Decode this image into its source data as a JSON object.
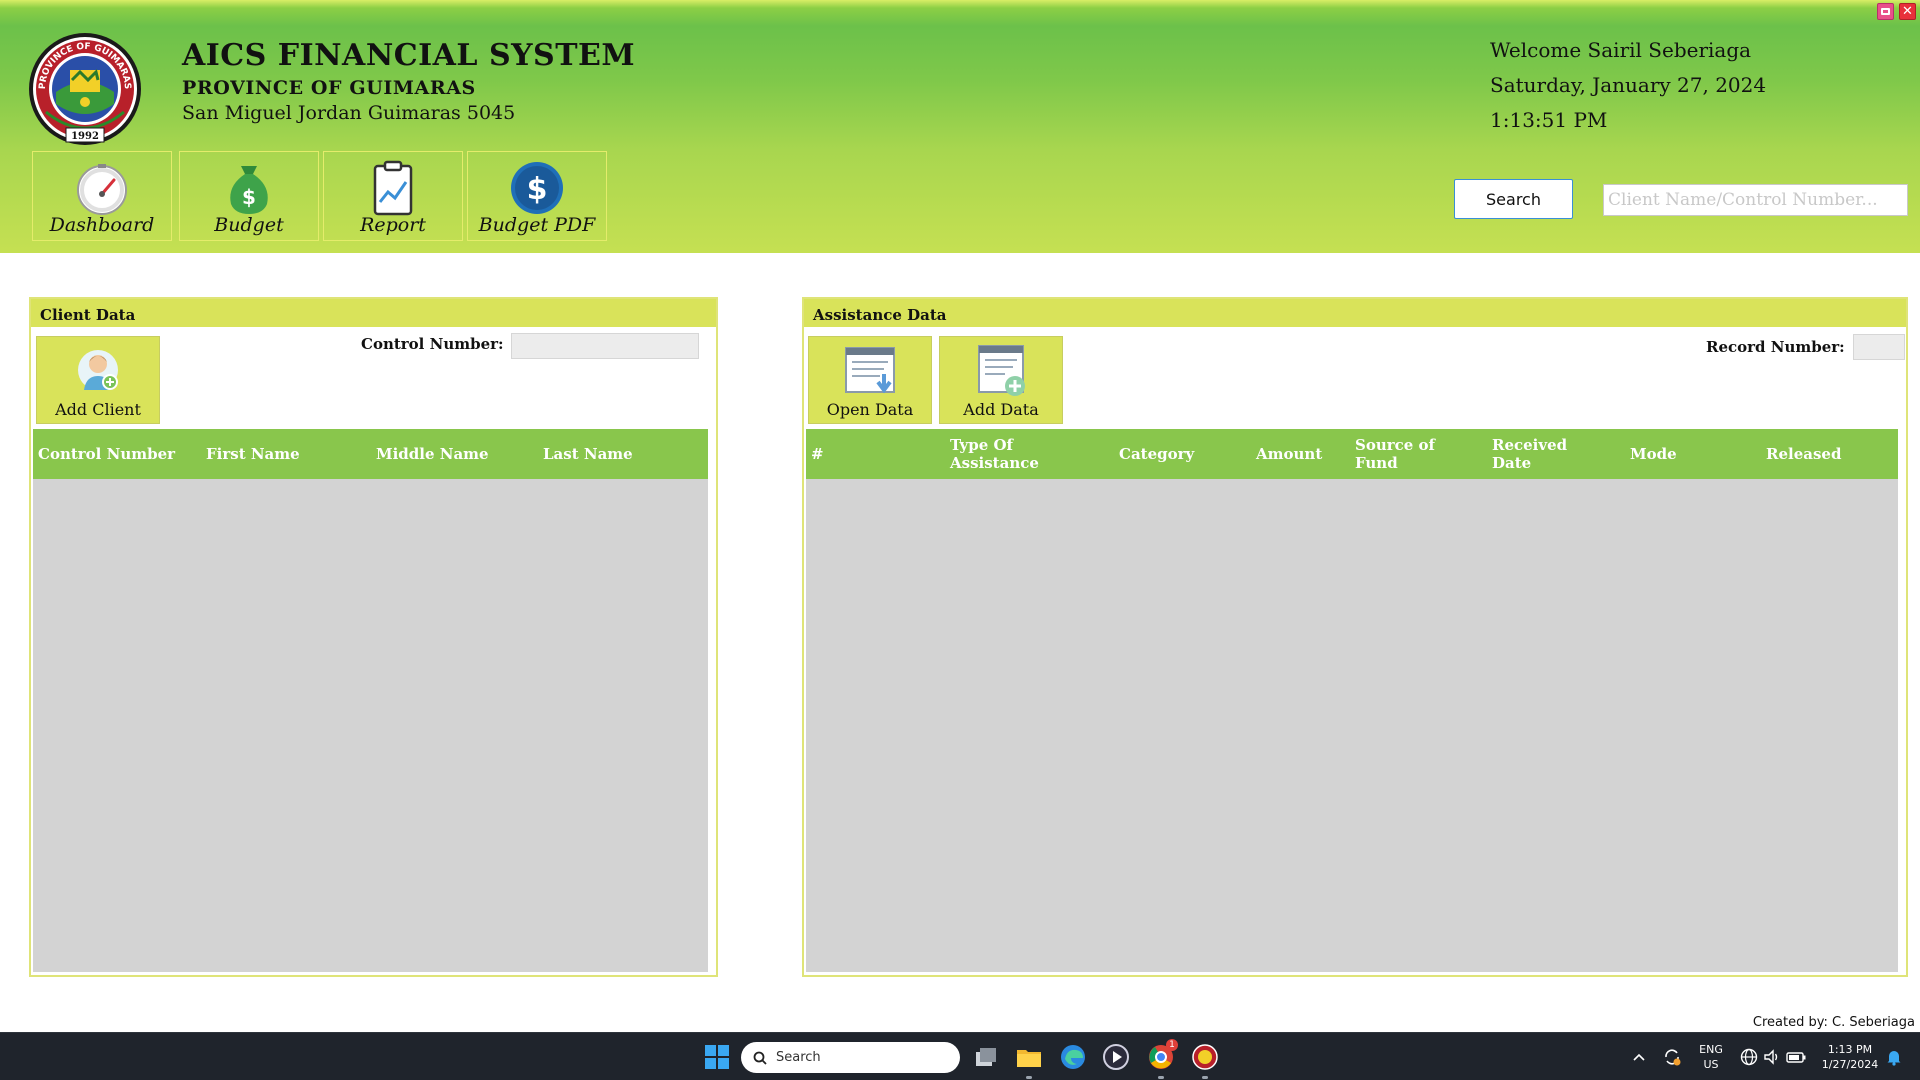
{
  "app": {
    "title": "AICS FINANCIAL SYSTEM",
    "province": "PROVINCE OF GUIMARAS",
    "address": "San Miguel Jordan Guimaras 5045",
    "logo_text": "PROVINCE OF GUIMARAS",
    "logo_year": "1992"
  },
  "session": {
    "welcome": "Welcome Sairil Seberiaga",
    "date": "Saturday, January 27, 2024",
    "time": "1:13:51 PM"
  },
  "nav": {
    "dashboard": "Dashboard",
    "budget": "Budget",
    "report": "Report",
    "budget_pdf": "Budget PDF"
  },
  "search": {
    "button_label": "Search",
    "placeholder": "Client Name/Control Number...",
    "value": ""
  },
  "client_panel": {
    "title": "Client Data",
    "add_button": "Add Client",
    "control_number_label": "Control Number:",
    "columns": [
      "Control Number",
      "First Name",
      "Middle Name",
      "Last Name"
    ],
    "rows": []
  },
  "assistance_panel": {
    "title": "Assistance Data",
    "open_button": "Open Data",
    "add_button": "Add Data",
    "record_number_label": "Record Number:",
    "columns": [
      "#",
      "Type Of Assistance",
      "Category",
      "Amount",
      "Source of Fund",
      "Received Date",
      "Mode",
      "Released"
    ],
    "rows": []
  },
  "footer": {
    "credit": "Created by: C. Seberiaga"
  },
  "taskbar": {
    "search_label": "Search",
    "lang_top": "ENG",
    "lang_bottom": "US",
    "clock_time": "1:13 PM",
    "clock_date": "1/27/2024",
    "chrome_badge": "1"
  },
  "colors": {
    "header_green": "#6cc14a",
    "panel_head": "#d9e35a",
    "grid_head": "#89c64c",
    "grid_body": "#d3d3d3"
  }
}
